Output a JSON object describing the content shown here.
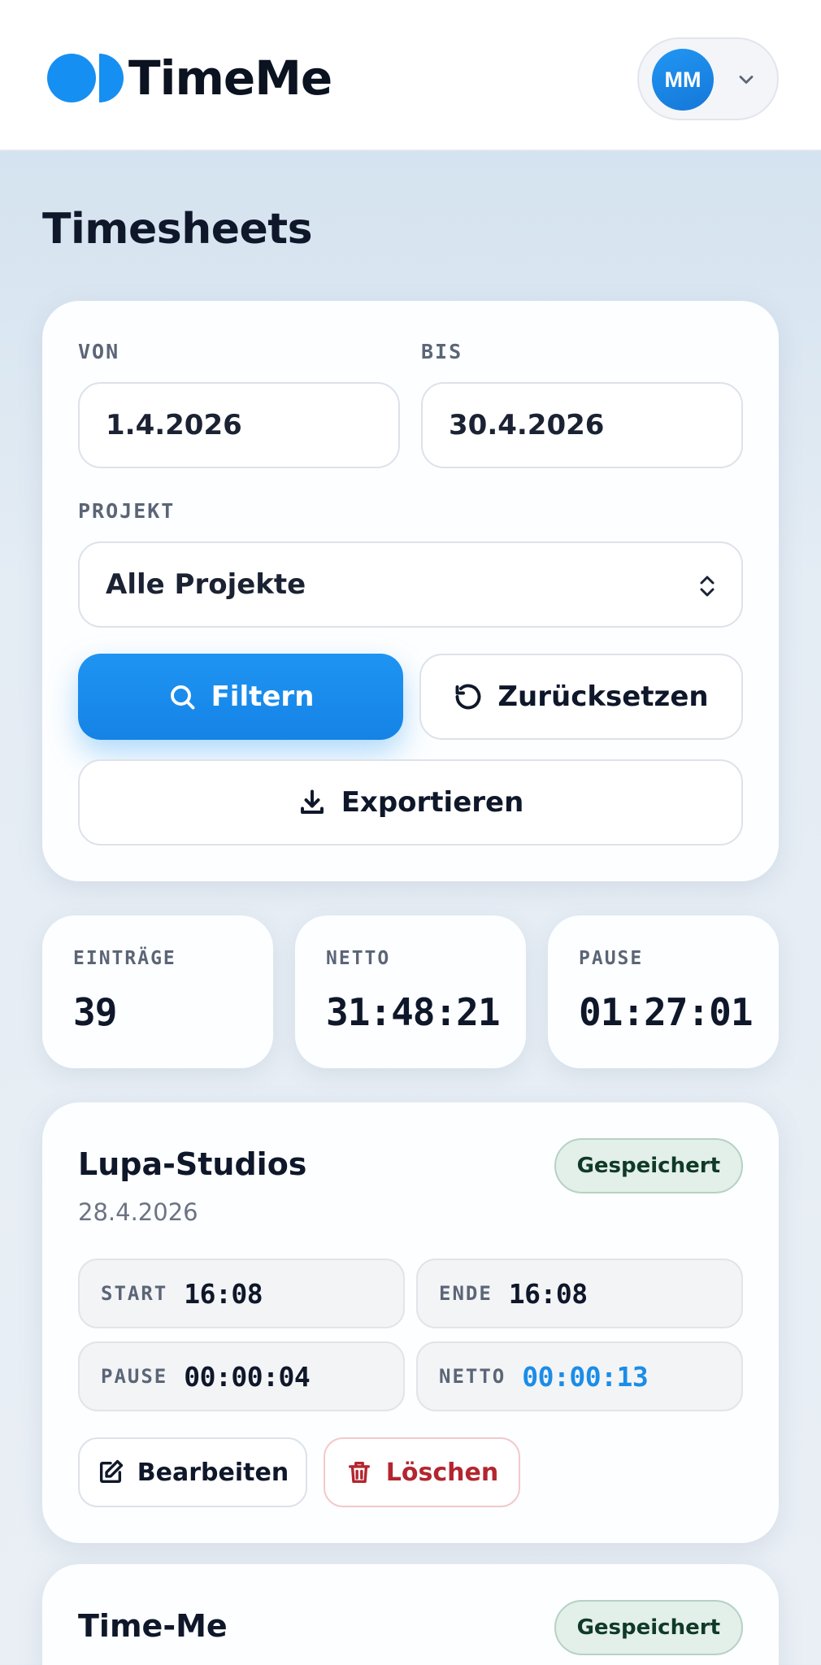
{
  "header": {
    "brand": "TimeMe",
    "user_initials": "MM",
    "icons": {
      "logo": "timeme-logo",
      "menu": "chevron-down-icon"
    }
  },
  "page": {
    "title": "Timesheets"
  },
  "filters": {
    "from_label": "VON",
    "from_value": "1.4.2026",
    "to_label": "BIS",
    "to_value": "30.4.2026",
    "project_label": "PROJEKT",
    "project_value": "Alle Projekte",
    "filter_button": "Filtern",
    "reset_button": "Zurücksetzen",
    "export_button": "Exportieren"
  },
  "stats": [
    {
      "label": "EINTRÄGE",
      "value": "39"
    },
    {
      "label": "NETTO",
      "value": "31:48:21"
    },
    {
      "label": "PAUSE",
      "value": "01:27:01"
    }
  ],
  "entries": [
    {
      "project": "Lupa-Studios",
      "date": "28.4.2026",
      "status": "Gespeichert",
      "start_label": "START",
      "start": "16:08",
      "end_label": "ENDE",
      "end": "16:08",
      "pause_label": "PAUSE",
      "pause": "00:00:04",
      "net_label": "NETTO",
      "net": "00:00:13",
      "edit_label": "Bearbeiten",
      "delete_label": "Löschen"
    },
    {
      "project": "Time-Me",
      "status": "Gespeichert"
    }
  ],
  "colors": {
    "accent": "#1e94f2",
    "badge_bg": "#e3efe9",
    "danger": "#b3262f",
    "text": "#0f172a"
  }
}
